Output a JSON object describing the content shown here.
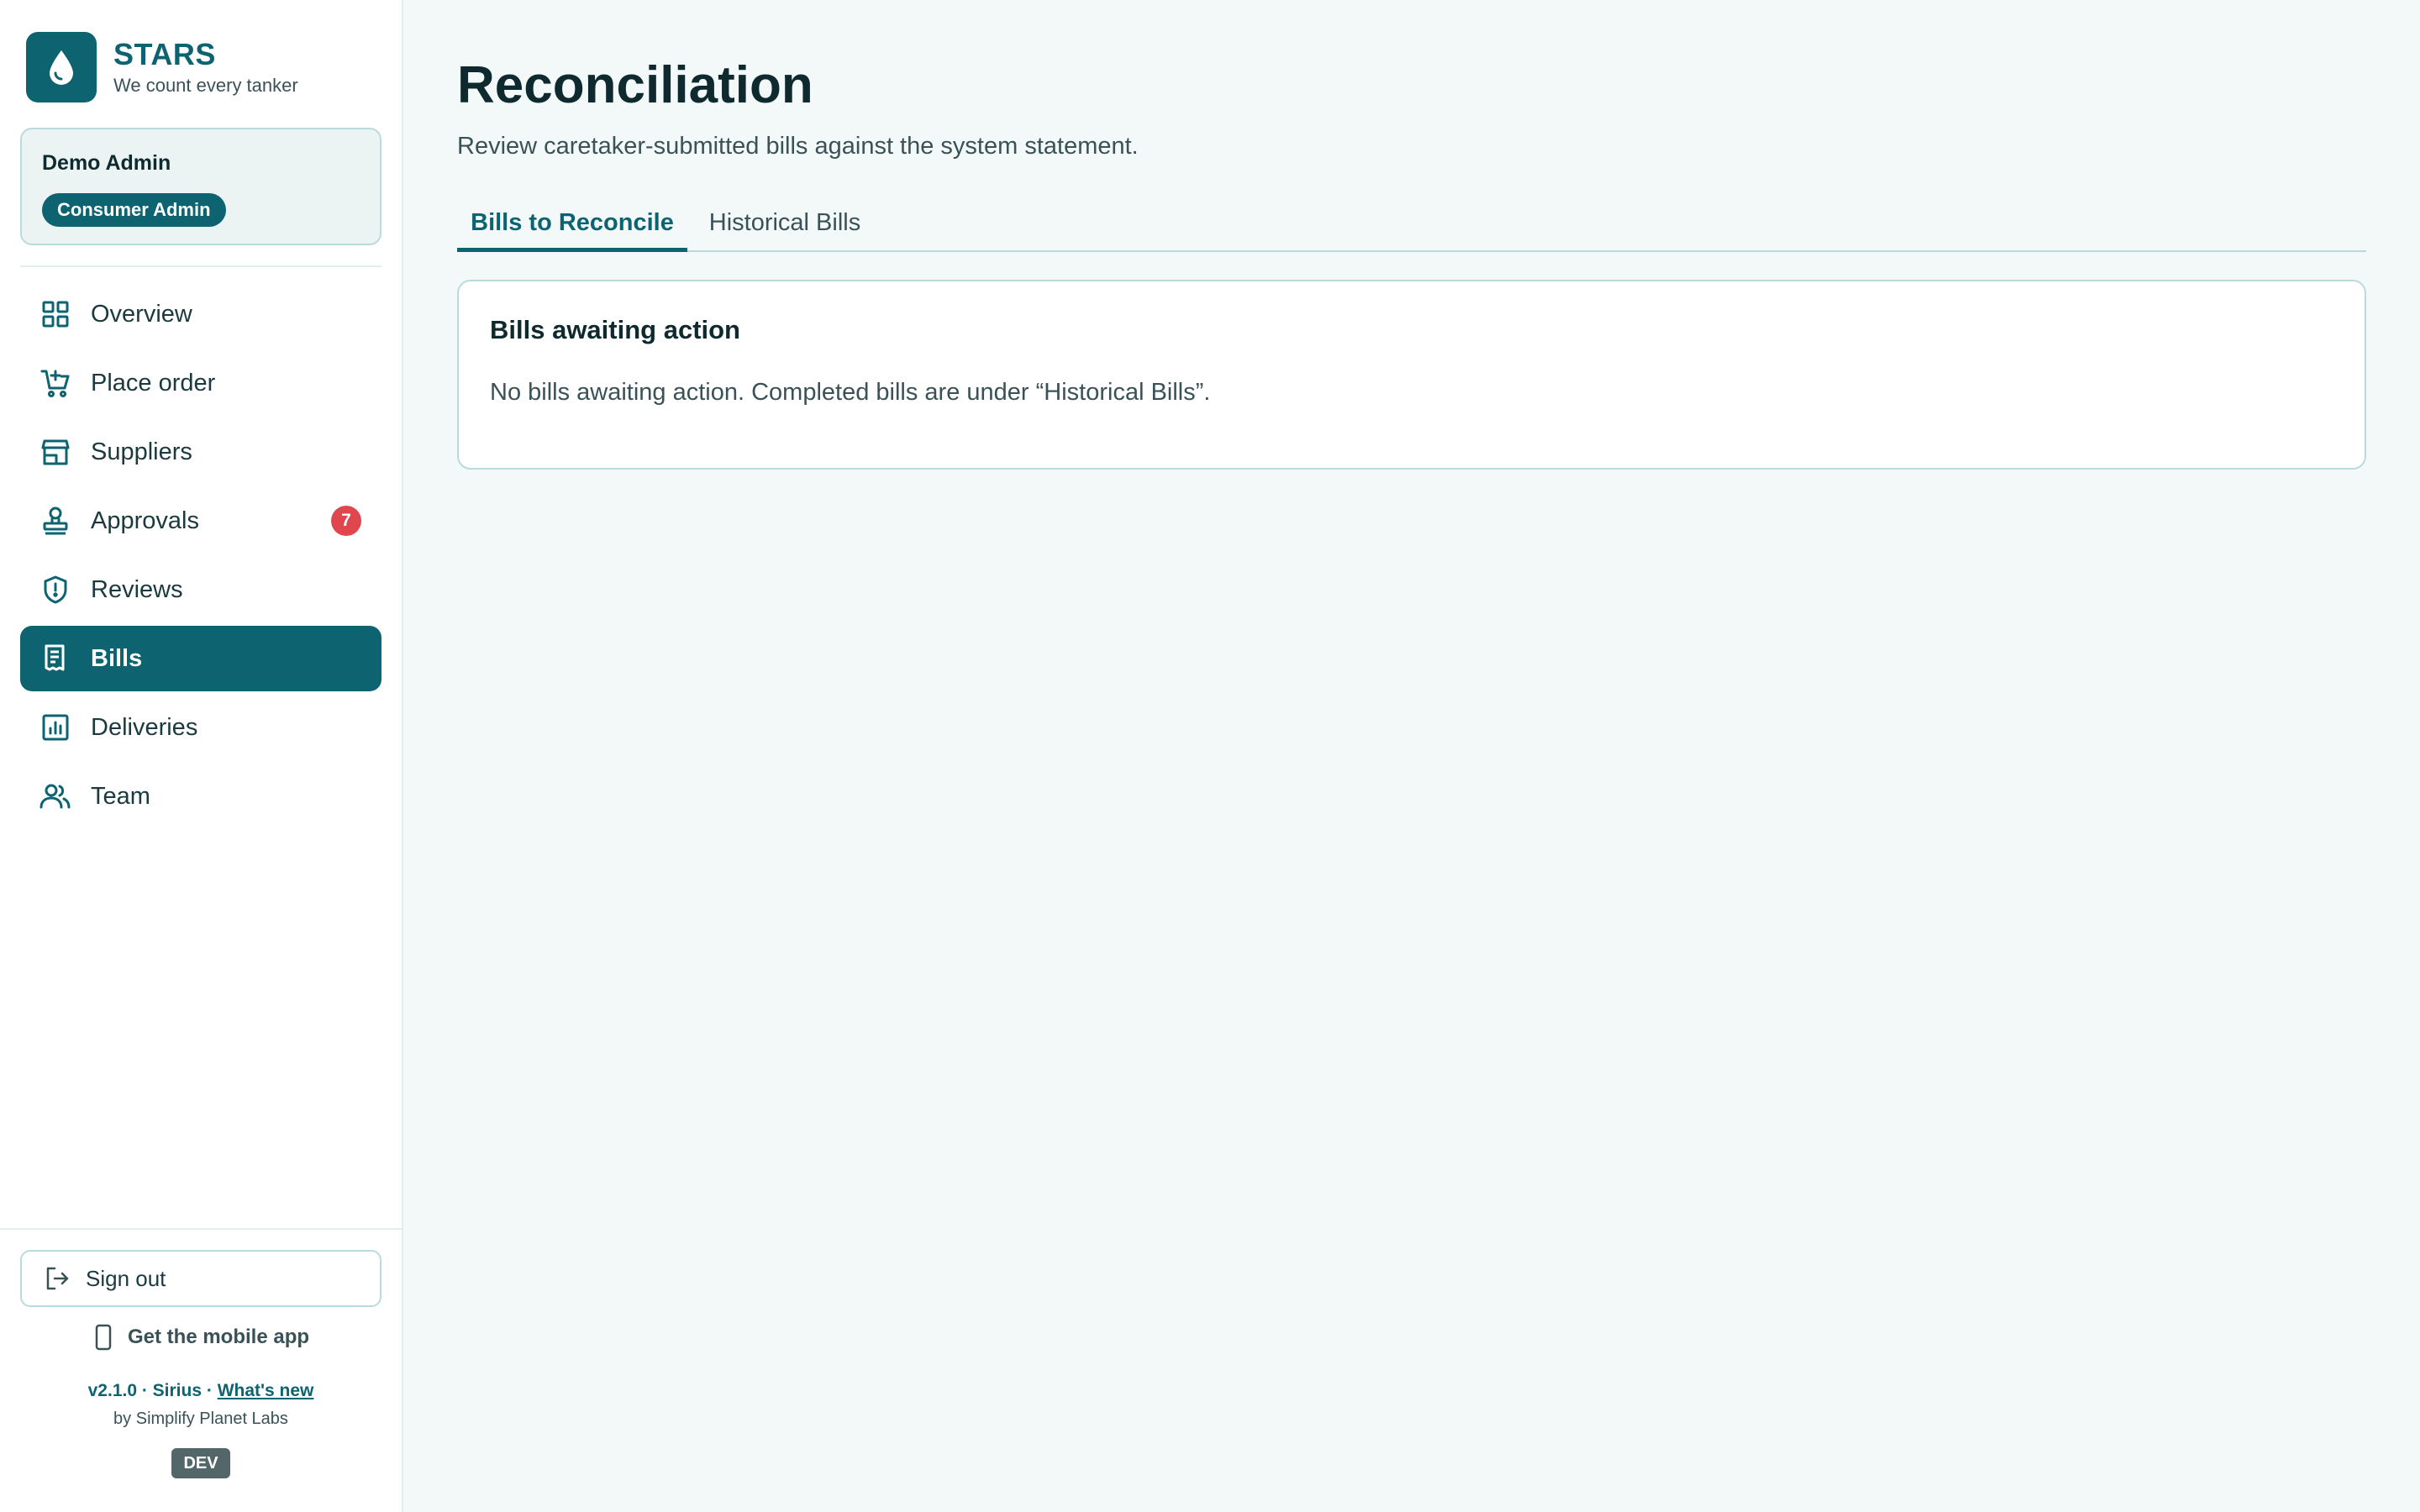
{
  "brand": {
    "name": "STARS",
    "tagline": "We count every tanker"
  },
  "user": {
    "name": "Demo Admin",
    "role": "Consumer Admin"
  },
  "nav": {
    "items": [
      {
        "label": "Overview",
        "icon": "grid-icon"
      },
      {
        "label": "Place order",
        "icon": "cart-plus-icon"
      },
      {
        "label": "Suppliers",
        "icon": "store-icon"
      },
      {
        "label": "Approvals",
        "icon": "stamp-icon",
        "badge": "7"
      },
      {
        "label": "Reviews",
        "icon": "shield-alert-icon"
      },
      {
        "label": "Bills",
        "icon": "receipt-icon",
        "active": true
      },
      {
        "label": "Deliveries",
        "icon": "bar-chart-icon"
      },
      {
        "label": "Team",
        "icon": "people-icon"
      }
    ]
  },
  "footer": {
    "signout_label": "Sign out",
    "mobile_app_label": "Get the mobile app",
    "version": "v2.1.0 · Sirius · ",
    "whats_new": "What's new",
    "byline": "by Simplify Planet Labs",
    "env": "DEV"
  },
  "page": {
    "title": "Reconciliation",
    "subtitle": "Review caretaker-submitted bills against the system statement.",
    "tabs": [
      {
        "label": "Bills to Reconcile",
        "active": true
      },
      {
        "label": "Historical Bills",
        "active": false
      }
    ],
    "panel": {
      "title": "Bills awaiting action",
      "empty_message": "No bills awaiting action. Completed bills are under “Historical Bills”."
    }
  },
  "colors": {
    "accent": "#0d6470",
    "badge": "#e0464e",
    "background": "#f3f9f9",
    "border": "#b9dbdc"
  }
}
